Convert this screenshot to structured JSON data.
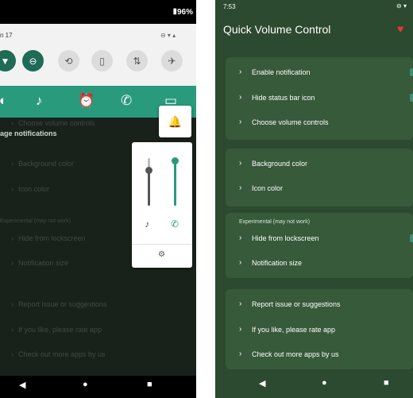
{
  "left": {
    "status": {
      "battery": "96%"
    },
    "shade": {
      "date": "n 17"
    },
    "quick_settings": [
      {
        "icon": "wifi-icon",
        "glyph": "▼",
        "on": true
      },
      {
        "icon": "dnd-icon",
        "glyph": "⊖",
        "on": true
      },
      {
        "icon": "rotate-icon",
        "glyph": "⟲",
        "on": false
      },
      {
        "icon": "battery-saver-icon",
        "glyph": "▯",
        "on": false
      },
      {
        "icon": "data-icon",
        "glyph": "⇅",
        "on": false
      },
      {
        "icon": "airplane-icon",
        "glyph": "✈",
        "on": false
      }
    ],
    "volume_bar_icons": [
      "ring-icon",
      "music-icon",
      "alarm-icon",
      "call-icon",
      "cast-icon"
    ],
    "background_rows": [
      "Choose volume controls",
      "age notifications",
      "Background color",
      "Icon color",
      "Experimental (may not work)",
      "Hide from lockscreen",
      "Notification size",
      "Report issue or suggestions",
      "If you like, please rate app",
      "Check out more apps by us"
    ],
    "sliders": [
      {
        "name": "media",
        "level": 0.25,
        "color": "#555555",
        "icon": "♪"
      },
      {
        "name": "call",
        "level": 0.05,
        "color": "#2a9a7d",
        "icon": "✆"
      }
    ]
  },
  "right": {
    "status": {
      "time": "7:53"
    },
    "appbar": {
      "title": "Quick Volume Control"
    },
    "accent": "#e53935",
    "groups": [
      {
        "items": [
          "Enable notification",
          "Hide status bar icon",
          "Choose volume controls"
        ]
      },
      {
        "items": [
          "Background color",
          "Icon color"
        ]
      },
      {
        "header": "Experimental (may not work)",
        "items": [
          "Hide from lockscreen",
          "Notification size"
        ]
      },
      {
        "items": [
          "Report issue or suggestions",
          "If you like, please rate app",
          "Check out more apps by us"
        ]
      }
    ]
  },
  "colors": {
    "teal": "#2a9a7d",
    "dark_green": "#2c4a2f",
    "card_green": "#365a3a"
  }
}
